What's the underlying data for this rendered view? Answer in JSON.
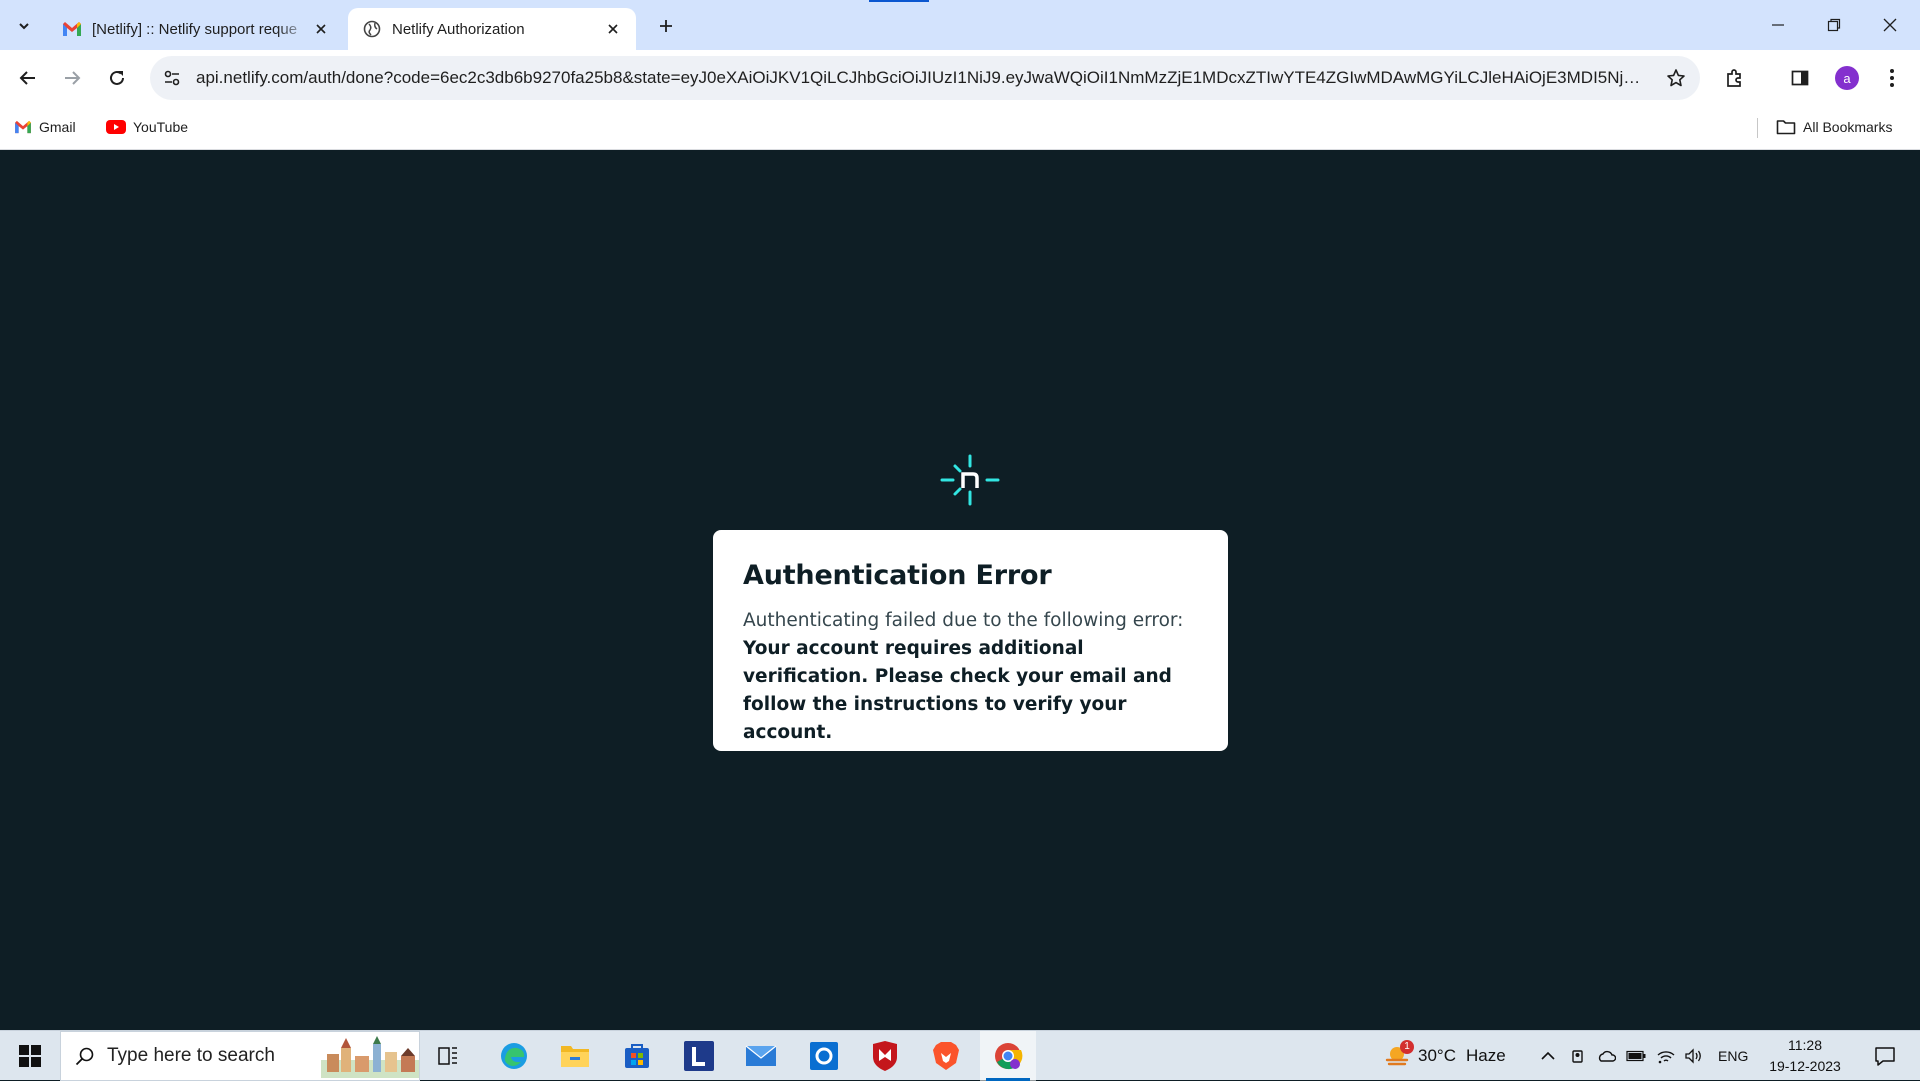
{
  "browser": {
    "tabs": [
      {
        "title": "[Netlify] :: Netlify support reque",
        "favicon": "gmail-icon",
        "active": false
      },
      {
        "title": "Netlify Authorization",
        "favicon": "globe-icon",
        "active": true
      }
    ],
    "address_bar": {
      "url": "api.netlify.com/auth/done?code=6ec2c3db6b9270fa25b8&state=eyJ0eXAiOiJKV1QiLCJhbGciOiJIUzI1NiJ9.eyJwaWQiOiI1NmMzZjE1MDcxZTIwYTE4ZGIwMDAwMGYiLCJleHAiOjE3MDI5NjU2..."
    },
    "profile_initial": "a",
    "bookmarks": [
      {
        "label": "Gmail",
        "icon": "gmail-icon"
      },
      {
        "label": "YouTube",
        "icon": "youtube-icon"
      }
    ],
    "all_bookmarks_label": "All Bookmarks"
  },
  "page": {
    "logo": "netlify-logo",
    "error_title": "Authentication Error",
    "error_lead": "Authenticating failed due to the following error:",
    "error_message": "Your account requires additional verification. Please check your email and follow the instructions to verify your account."
  },
  "taskbar": {
    "search_placeholder": "Type here to search",
    "apps": [
      "task-view-icon",
      "edge-icon",
      "file-explorer-icon",
      "microsoft-store-icon",
      "l-app-icon",
      "mail-icon",
      "outlook-icon",
      "mcafee-icon",
      "brave-icon",
      "chrome-icon"
    ],
    "weather": {
      "temp": "30°C",
      "condition": "Haze",
      "badge": "1"
    },
    "language": "ENG",
    "time": "11:28",
    "date": "19-12-2023"
  },
  "colors": {
    "page_background": "#0e1e25",
    "netlify_accent": "#32e6e2",
    "tabstrip": "#d3e3fd",
    "profile": "#8430ce"
  }
}
